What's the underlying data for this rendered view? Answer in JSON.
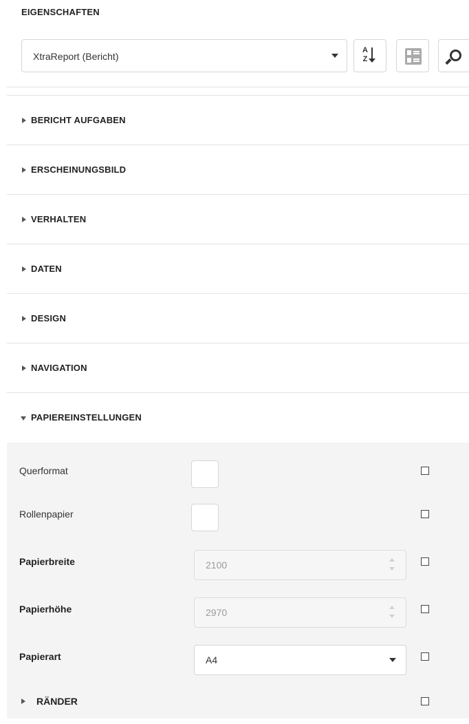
{
  "panel_title": "EIGENSCHAFTEN",
  "object_selector": {
    "value": "XtraReport (Bericht)"
  },
  "toolbar": {
    "sort_icon": "sort-alphabetical-icon",
    "sort_letters": "A Z",
    "categories_icon": "categorized-view-icon",
    "search_icon": "search-icon"
  },
  "sections": [
    {
      "label": "BERICHT AUFGABEN",
      "expanded": false
    },
    {
      "label": "ERSCHEINUNGSBILD",
      "expanded": false
    },
    {
      "label": "VERHALTEN",
      "expanded": false
    },
    {
      "label": "DATEN",
      "expanded": false
    },
    {
      "label": "DESIGN",
      "expanded": false
    },
    {
      "label": "NAVIGATION",
      "expanded": false
    },
    {
      "label": "PAPIEREINSTELLUNGEN",
      "expanded": true
    }
  ],
  "paper_settings": {
    "landscape": {
      "label": "Querformat",
      "checked": false
    },
    "roll_paper": {
      "label": "Rollenpapier",
      "checked": false
    },
    "paper_width": {
      "label": "Papierbreite",
      "value": "2100"
    },
    "paper_height": {
      "label": "Papierhöhe",
      "value": "2970"
    },
    "paper_kind": {
      "label": "Papierart",
      "value": "A4"
    },
    "margins": {
      "label": "RÄNDER"
    }
  }
}
